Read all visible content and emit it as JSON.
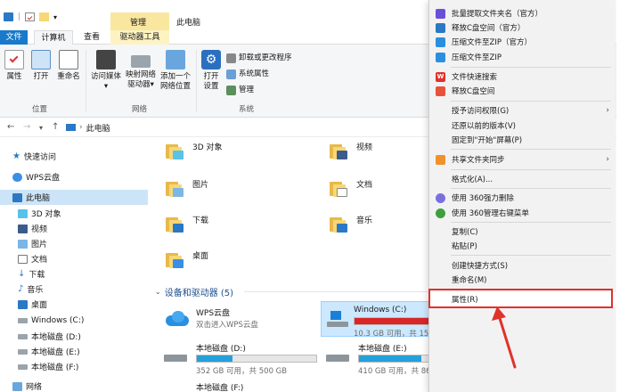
{
  "title_bar": {
    "context_tab": "管理",
    "window_title": "此电脑"
  },
  "tabs": {
    "file": "文件",
    "computer": "计算机",
    "view": "查看",
    "drive_tools": "驱动器工具"
  },
  "ribbon": {
    "properties": "属性",
    "open": "打开",
    "rename": "重命名",
    "access_media": "访问媒体",
    "map_drive_line1": "映射网络",
    "map_drive_line2": "驱动器",
    "add_location_line1": "添加一个",
    "add_location_line2": "网络位置",
    "open_settings_line1": "打开",
    "open_settings_line2": "设置",
    "uninstall": "卸载或更改程序",
    "sys_props": "系统属性",
    "manage": "管理",
    "group_location": "位置",
    "group_network": "网络",
    "group_system": "系统"
  },
  "address": {
    "path": "此电脑"
  },
  "nav": [
    {
      "label": "快速访问",
      "icon": "star-icon"
    },
    {
      "label": "WPS云盘",
      "icon": "cloud-icon"
    },
    {
      "label": "此电脑",
      "icon": "computer-icon"
    },
    {
      "label": "3D 对象",
      "icon": "cube-icon"
    },
    {
      "label": "视频",
      "icon": "video-icon"
    },
    {
      "label": "图片",
      "icon": "picture-icon"
    },
    {
      "label": "文档",
      "icon": "document-icon"
    },
    {
      "label": "下载",
      "icon": "download-icon"
    },
    {
      "label": "音乐",
      "icon": "music-icon"
    },
    {
      "label": "桌面",
      "icon": "desktop-icon"
    },
    {
      "label": "Windows (C:)",
      "icon": "drive-icon"
    },
    {
      "label": "本地磁盘 (D:)",
      "icon": "drive-icon"
    },
    {
      "label": "本地磁盘 (E:)",
      "icon": "drive-icon"
    },
    {
      "label": "本地磁盘 (F:)",
      "icon": "drive-icon"
    },
    {
      "label": "网络",
      "icon": "network-icon"
    }
  ],
  "folders": [
    {
      "label": "3D 对象"
    },
    {
      "label": "视频"
    },
    {
      "label": "图片"
    },
    {
      "label": "文档"
    },
    {
      "label": "下载"
    },
    {
      "label": "音乐"
    },
    {
      "label": "桌面"
    }
  ],
  "section": {
    "title": "设备和驱动器 (5)"
  },
  "drives": [
    {
      "name": "WPS云盘",
      "subtitle": "双击进入WPS云盘"
    },
    {
      "name": "Windows (C:)",
      "free": "10.3 GB 可用，共 159 GB",
      "used_fraction": 0.935
    },
    {
      "name": "本地磁盘 (D:)",
      "free": "352 GB 可用，共 500 GB",
      "used_fraction": 0.296
    },
    {
      "name": "本地磁盘 (E:)",
      "free": "410 GB 可用，共 863 GB",
      "used_fraction": 0.525
    },
    {
      "name": "本地磁盘 (F:)"
    }
  ],
  "context_menu": {
    "items": [
      {
        "label": "批量提取文件夹名（官方）",
        "icon": "wps-tool-icon"
      },
      {
        "label": "释放C盘空间（官方）",
        "icon": "wps-tool-icon"
      },
      {
        "label": "压缩文件至ZIP（官方）",
        "icon": "zip-icon"
      },
      {
        "label": "压缩文件至ZIP",
        "icon": "zip-icon"
      },
      {
        "label": "文件快速搜索",
        "icon": "wps-w-icon"
      },
      {
        "label": "释放C盘空间",
        "icon": "clean-icon"
      },
      {
        "label": "授予访问权限(G)"
      },
      {
        "label": "还原以前的版本(V)"
      },
      {
        "label": "固定到\"开始\"屏幕(P)"
      },
      {
        "label": "共享文件夹同步",
        "icon": "sync-icon"
      },
      {
        "label": "格式化(A)..."
      },
      {
        "label": "使用 360强力删除",
        "icon": "360-delete-icon"
      },
      {
        "label": "使用 360管理右键菜单",
        "icon": "360-menu-icon"
      },
      {
        "label": "复制(C)"
      },
      {
        "label": "粘贴(P)"
      },
      {
        "label": "创建快捷方式(S)"
      },
      {
        "label": "重命名(M)"
      },
      {
        "label": "属性(R)"
      }
    ]
  },
  "colors": {
    "accent": "#1979ca",
    "drive_fill": "#26a0da",
    "drive_full": "#da2626",
    "highlight_box": "#e0322b"
  }
}
